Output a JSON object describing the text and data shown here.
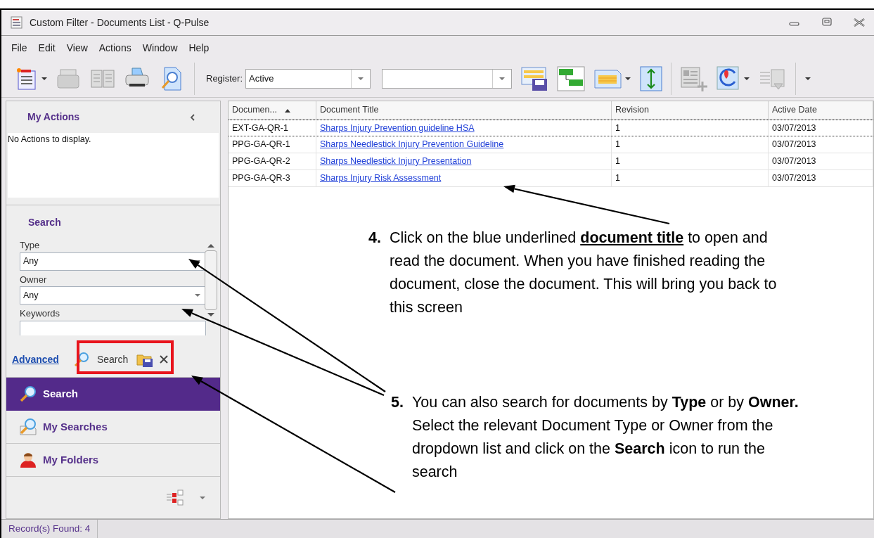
{
  "window": {
    "title": "Custom Filter - Documents List - Q-Pulse"
  },
  "menu": [
    "File",
    "Edit",
    "View",
    "Actions",
    "Window",
    "Help"
  ],
  "toolbar": {
    "register_label": "Register:",
    "register_value": "Active"
  },
  "my_actions": {
    "title": "My Actions",
    "message": "No Actions to display."
  },
  "search_panel": {
    "title": "Search",
    "fields": [
      {
        "label": "Type",
        "kind": "dropdown",
        "value": "Any"
      },
      {
        "label": "Owner",
        "kind": "dropdown",
        "value": "Any"
      },
      {
        "label": "Keywords",
        "kind": "text"
      }
    ],
    "advanced_link": "Advanced",
    "search_button": "Search"
  },
  "nav": [
    {
      "label": "Search",
      "selected": true
    },
    {
      "label": "My Searches",
      "selected": false
    },
    {
      "label": "My Folders",
      "selected": false
    }
  ],
  "table": {
    "columns": [
      {
        "label": "Documen...",
        "sorted": true
      },
      {
        "label": "Document Title",
        "sorted": false
      },
      {
        "label": "Revision",
        "sorted": false
      },
      {
        "label": "Active Date",
        "sorted": false
      }
    ],
    "rows": [
      {
        "focused": true,
        "cells": [
          "EXT-GA-QR-1",
          "Sharps Injury Prevention guideline HSA",
          "1",
          "03/07/2013"
        ]
      },
      {
        "focused": false,
        "cells": [
          "PPG-GA-QR-1",
          "Sharps Needlestick Injury Prevention Guideline",
          "1",
          "03/07/2013"
        ]
      },
      {
        "focused": false,
        "cells": [
          "PPG-GA-QR-2",
          "Sharps Needlestick Injury Presentation",
          "1",
          "03/07/2013"
        ]
      },
      {
        "focused": false,
        "cells": [
          "PPG-GA-QR-3",
          "Sharps Injury Risk Assessment",
          "1",
          "03/07/2013"
        ]
      }
    ]
  },
  "status_bar": "Record(s) Found: 4",
  "annotations": [
    {
      "number": "4.",
      "text": "Click on the blue underlined **document title** to open and read the document. When you have finished reading the document, close the document.  This will bring you back to this screen"
    },
    {
      "number": "5.",
      "text": "You can also search for documents by **Type** or by **Owner.**  Select the relevant Document Type or Owner from the dropdown list and click on the **Search** icon to run the search"
    }
  ]
}
